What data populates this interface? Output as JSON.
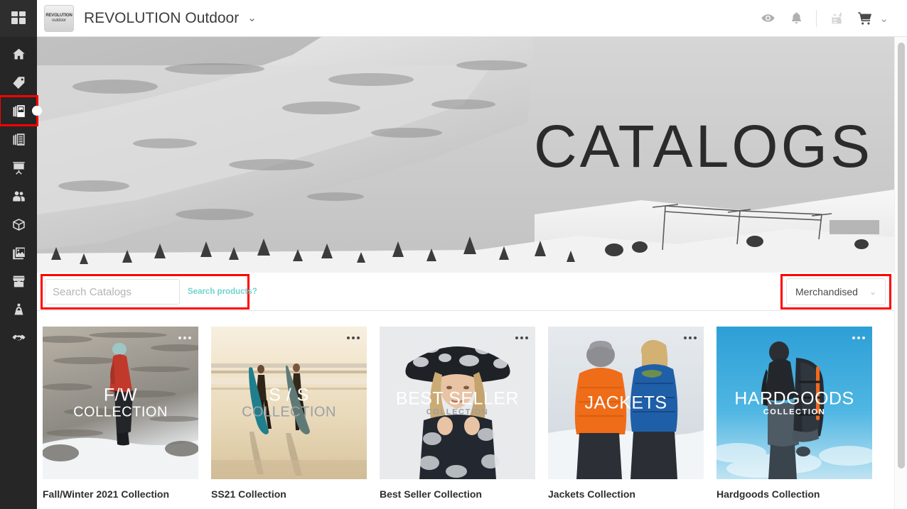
{
  "app": {
    "launcher_icon": "grid-icon"
  },
  "sidebar": {
    "items": [
      {
        "icon": "home-icon",
        "name": "home",
        "active": false
      },
      {
        "icon": "tag-icon",
        "name": "products",
        "active": false
      },
      {
        "icon": "catalog-icon",
        "name": "catalogs",
        "active": true
      },
      {
        "icon": "lists-icon",
        "name": "lists",
        "active": false
      },
      {
        "icon": "presentation-icon",
        "name": "presentations",
        "active": false
      },
      {
        "icon": "people-icon",
        "name": "contacts",
        "active": false
      },
      {
        "icon": "package-icon",
        "name": "orders",
        "active": false
      },
      {
        "icon": "images-icon",
        "name": "assets",
        "active": false
      },
      {
        "icon": "storefront-icon",
        "name": "showroom",
        "active": false
      },
      {
        "icon": "mannequin-icon",
        "name": "lookbook",
        "active": false
      },
      {
        "icon": "handshake-icon",
        "name": "partners",
        "active": false
      }
    ]
  },
  "header": {
    "logo_line1": "REVOLUTION",
    "logo_line2": "outdoor",
    "title": "REVOLUTION Outdoor",
    "title_caret": "⌄",
    "icons": [
      {
        "name": "eye-icon",
        "glyph": "eye"
      },
      {
        "name": "bell-icon",
        "glyph": "bell"
      },
      {
        "name": "list-star-icon",
        "glyph": "list-star"
      },
      {
        "name": "cart-icon",
        "glyph": "cart"
      }
    ],
    "user_caret": "⌄"
  },
  "hero": {
    "title": "CATALOGS",
    "image_alt": "snowy-mountain-ski-resort"
  },
  "filterbar": {
    "search_placeholder": "Search Catalogs",
    "search_value": "",
    "search_alt_link": "Search products?",
    "sort_value": "Merchandised",
    "sort_caret": "⌄",
    "sort_options": [
      "Merchandised"
    ]
  },
  "cards": [
    {
      "title": "Fall/Winter 2021 Collection",
      "overlay_main": "F/W",
      "overlay_sub": "COLLECTION",
      "overlay_sub_small": false,
      "overlay_sub_dim": false,
      "menu_light": true,
      "image_alt": "woman-in-red-jacket-on-snow"
    },
    {
      "title": "SS21 Collection",
      "overlay_main": "S / S",
      "overlay_sub": "COLLECTION",
      "overlay_sub_small": false,
      "overlay_sub_dim": true,
      "menu_light": false,
      "image_alt": "two-surfers-walking-on-beach-at-sunset"
    },
    {
      "title": "Best Seller Collection",
      "overlay_main": "BEST SELLER",
      "overlay_sub": "COLLECTION",
      "overlay_sub_small": true,
      "overlay_sub_dim": true,
      "menu_light": false,
      "image_alt": "woman-in-floral-bucket-hat-and-jacket"
    },
    {
      "title": "Jackets Collection",
      "overlay_main": "JACKETS",
      "overlay_sub": "",
      "overlay_sub_small": false,
      "overlay_sub_dim": false,
      "menu_light": false,
      "image_alt": "two-people-in-orange-and-blue-puffer-jackets"
    },
    {
      "title": "Hardgoods Collection",
      "overlay_main": "HARDGOODS",
      "overlay_sub": "COLLECTION",
      "overlay_sub_small": true,
      "overlay_sub_dim": false,
      "menu_light": true,
      "image_alt": "hiker-with-backpack-against-blue-sky"
    }
  ],
  "colors": {
    "sidebar_bg": "#262626",
    "highlight_red": "#ff0000",
    "link_teal": "#6fd4cf",
    "text_dark": "#2f2f2f"
  }
}
